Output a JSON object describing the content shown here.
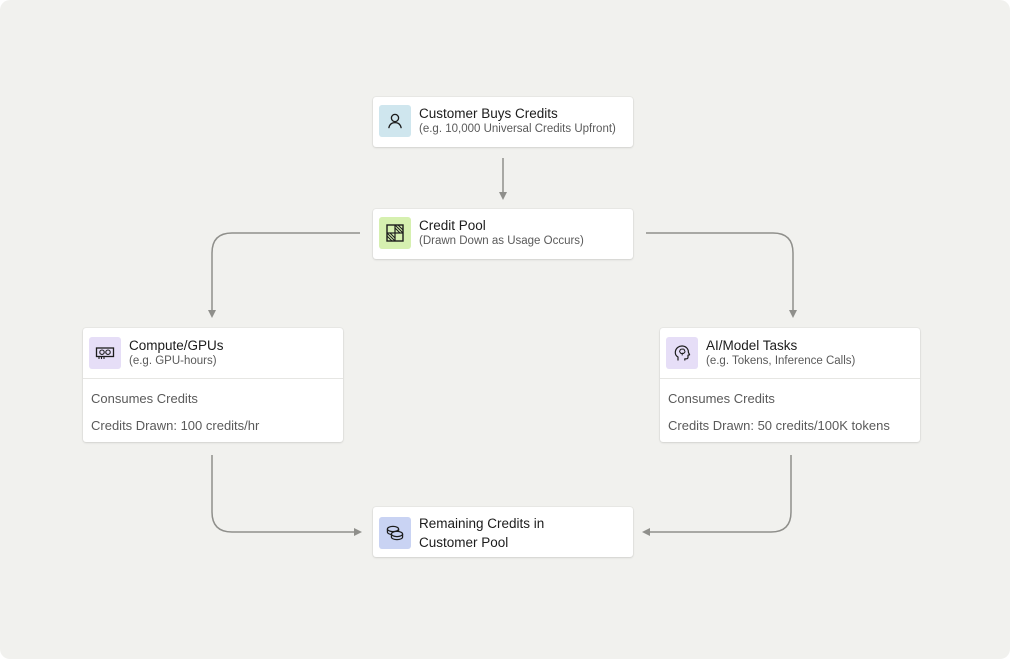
{
  "nodes": {
    "customer": {
      "title": "Customer Buys Credits",
      "subtitle": "(e.g. 10,000 Universal Credits Upfront)",
      "icon": "user-icon",
      "icon_bg": "#cfe6ee"
    },
    "pool": {
      "title": "Credit Pool",
      "subtitle": "(Drawn Down as Usage Occurs)",
      "icon": "pool-grid-icon",
      "icon_bg": "#d6f0b0"
    },
    "compute": {
      "title": "Compute/GPUs",
      "subtitle": "(e.g. GPU-hours)",
      "icon": "gpu-icon",
      "icon_bg": "#e6def7",
      "line1": "Consumes Credits",
      "line2": "Credits Drawn: 100 credits/hr"
    },
    "ai": {
      "title": "AI/Model Tasks",
      "subtitle": "(e.g. Tokens, Inference Calls)",
      "icon": "brain-head-icon",
      "icon_bg": "#e6def7",
      "line1": "Consumes Credits",
      "line2": "Credits Drawn: 50 credits/100K tokens"
    },
    "remaining": {
      "title_line1": "Remaining Credits in",
      "title_line2": "Customer Pool",
      "icon": "coins-icon",
      "icon_bg": "#c9d3f3"
    }
  },
  "colors": {
    "background": "#f1f1ee",
    "connector": "#8f8f8b"
  }
}
